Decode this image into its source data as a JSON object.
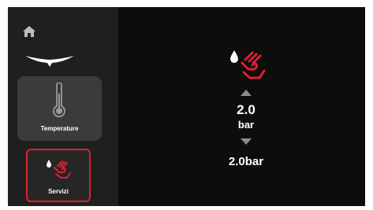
{
  "colors": {
    "screen_bg": "#0d0d0d",
    "sidebar_bg": "#1f1f1f",
    "card_active_bg": "#3b3b3b",
    "accent_red": "#e01f2c",
    "arrow_gray": "#8c8c8c",
    "text": "#ffffff"
  },
  "sidebar": {
    "home_icon": "home-icon",
    "logo": "brand-wings-logo",
    "items": [
      {
        "label": "Temperature",
        "icon": "thermometer-icon"
      },
      {
        "label": "Servizi",
        "icon": "water-hand-icon"
      }
    ]
  },
  "main": {
    "icon": "water-hand-icon",
    "value": "2.0",
    "unit": "bar",
    "summary": "2.0bar"
  }
}
